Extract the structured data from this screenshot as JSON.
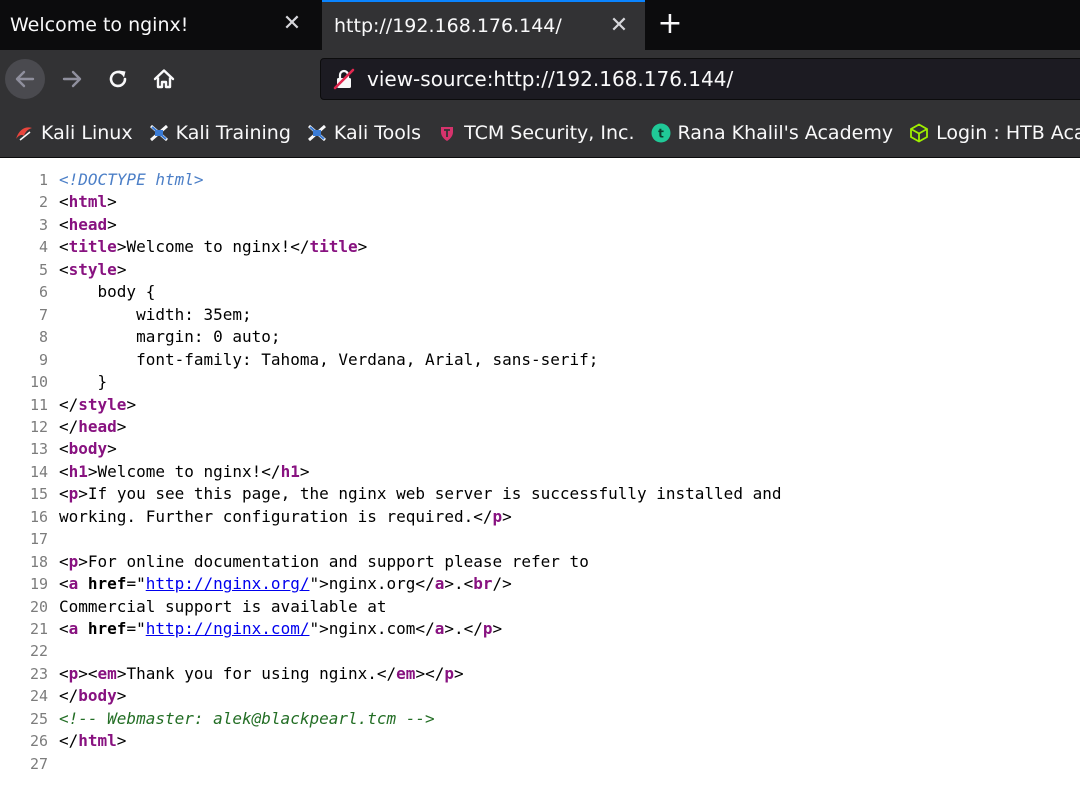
{
  "tabs": [
    {
      "title": "Welcome to nginx!",
      "active": false
    },
    {
      "title": "http://192.168.176.144/",
      "active": true
    }
  ],
  "icons": {
    "tab_close": "close-icon",
    "new_tab": "plus-icon",
    "back": "back-arrow-icon",
    "forward": "forward-arrow-icon",
    "reload": "reload-icon",
    "home": "home-icon",
    "insecure": "insecure-lock-icon"
  },
  "glyphs": {
    "close": "✕",
    "plus": "+"
  },
  "address_bar": {
    "url": "view-source:http://192.168.176.144/"
  },
  "bookmarks": [
    {
      "label": "Kali Linux",
      "icon": "kali-dragon-icon",
      "color": "#e8453c"
    },
    {
      "label": "Kali Training",
      "icon": "kali-training-icon",
      "color": "#3a7bd5"
    },
    {
      "label": "Kali Tools",
      "icon": "kali-tools-icon",
      "color": "#3a7bd5"
    },
    {
      "label": "TCM Security, Inc.",
      "icon": "tcm-icon",
      "color": "#d6336c"
    },
    {
      "label": "Rana Khalil's Academy",
      "icon": "rana-academy-icon",
      "color": "#20c997"
    },
    {
      "label": "Login : HTB Acad",
      "icon": "htb-cube-icon",
      "color": "#9fef00"
    }
  ],
  "colors": {
    "tag": "#881280",
    "doctype": "#4c7fc7",
    "comment": "#236e25",
    "link": "#0000ee",
    "line_number": "#7c7c7c",
    "active_tab_accent": "#0a84ff"
  },
  "source_lines": [
    [
      {
        "t": "doctype",
        "s": "<!DOCTYPE html>"
      }
    ],
    [
      {
        "t": "text",
        "s": "<"
      },
      {
        "t": "tag",
        "s": "html"
      },
      {
        "t": "text",
        "s": ">"
      }
    ],
    [
      {
        "t": "text",
        "s": "<"
      },
      {
        "t": "tag",
        "s": "head"
      },
      {
        "t": "text",
        "s": ">"
      }
    ],
    [
      {
        "t": "text",
        "s": "<"
      },
      {
        "t": "tag",
        "s": "title"
      },
      {
        "t": "text",
        "s": ">Welcome to nginx!</"
      },
      {
        "t": "tag",
        "s": "title"
      },
      {
        "t": "text",
        "s": ">"
      }
    ],
    [
      {
        "t": "text",
        "s": "<"
      },
      {
        "t": "tag",
        "s": "style"
      },
      {
        "t": "text",
        "s": ">"
      }
    ],
    [
      {
        "t": "text",
        "s": "    body {"
      }
    ],
    [
      {
        "t": "text",
        "s": "        width: 35em;"
      }
    ],
    [
      {
        "t": "text",
        "s": "        margin: 0 auto;"
      }
    ],
    [
      {
        "t": "text",
        "s": "        font-family: Tahoma, Verdana, Arial, sans-serif;"
      }
    ],
    [
      {
        "t": "text",
        "s": "    }"
      }
    ],
    [
      {
        "t": "text",
        "s": "</"
      },
      {
        "t": "tag",
        "s": "style"
      },
      {
        "t": "text",
        "s": ">"
      }
    ],
    [
      {
        "t": "text",
        "s": "</"
      },
      {
        "t": "tag",
        "s": "head"
      },
      {
        "t": "text",
        "s": ">"
      }
    ],
    [
      {
        "t": "text",
        "s": "<"
      },
      {
        "t": "tag",
        "s": "body"
      },
      {
        "t": "text",
        "s": ">"
      }
    ],
    [
      {
        "t": "text",
        "s": "<"
      },
      {
        "t": "tag",
        "s": "h1"
      },
      {
        "t": "text",
        "s": ">Welcome to nginx!</"
      },
      {
        "t": "tag",
        "s": "h1"
      },
      {
        "t": "text",
        "s": ">"
      }
    ],
    [
      {
        "t": "text",
        "s": "<"
      },
      {
        "t": "tag",
        "s": "p"
      },
      {
        "t": "text",
        "s": ">If you see this page, the nginx web server is successfully installed and"
      }
    ],
    [
      {
        "t": "text",
        "s": "working. Further configuration is required.</"
      },
      {
        "t": "tag",
        "s": "p"
      },
      {
        "t": "text",
        "s": ">"
      }
    ],
    [],
    [
      {
        "t": "text",
        "s": "<"
      },
      {
        "t": "tag",
        "s": "p"
      },
      {
        "t": "text",
        "s": ">For online documentation and support please refer to"
      }
    ],
    [
      {
        "t": "text",
        "s": "<"
      },
      {
        "t": "tag",
        "s": "a "
      },
      {
        "t": "attr",
        "s": "href"
      },
      {
        "t": "text",
        "s": "=\""
      },
      {
        "t": "link",
        "s": "http://nginx.org/"
      },
      {
        "t": "text",
        "s": "\">nginx.org</"
      },
      {
        "t": "tag",
        "s": "a"
      },
      {
        "t": "text",
        "s": ">.<"
      },
      {
        "t": "tag",
        "s": "br"
      },
      {
        "t": "text",
        "s": "/>"
      }
    ],
    [
      {
        "t": "text",
        "s": "Commercial support is available at"
      }
    ],
    [
      {
        "t": "text",
        "s": "<"
      },
      {
        "t": "tag",
        "s": "a "
      },
      {
        "t": "attr",
        "s": "href"
      },
      {
        "t": "text",
        "s": "=\""
      },
      {
        "t": "link",
        "s": "http://nginx.com/"
      },
      {
        "t": "text",
        "s": "\">nginx.com</"
      },
      {
        "t": "tag",
        "s": "a"
      },
      {
        "t": "text",
        "s": ">.</"
      },
      {
        "t": "tag",
        "s": "p"
      },
      {
        "t": "text",
        "s": ">"
      }
    ],
    [],
    [
      {
        "t": "text",
        "s": "<"
      },
      {
        "t": "tag",
        "s": "p"
      },
      {
        "t": "text",
        "s": "><"
      },
      {
        "t": "tag",
        "s": "em"
      },
      {
        "t": "text",
        "s": ">Thank you for using nginx.</"
      },
      {
        "t": "tag",
        "s": "em"
      },
      {
        "t": "text",
        "s": "></"
      },
      {
        "t": "tag",
        "s": "p"
      },
      {
        "t": "text",
        "s": ">"
      }
    ],
    [
      {
        "t": "text",
        "s": "</"
      },
      {
        "t": "tag",
        "s": "body"
      },
      {
        "t": "text",
        "s": ">"
      }
    ],
    [
      {
        "t": "comment",
        "s": "<!-- Webmaster: alek@blackpearl.tcm -->"
      }
    ],
    [
      {
        "t": "text",
        "s": "</"
      },
      {
        "t": "tag",
        "s": "html"
      },
      {
        "t": "text",
        "s": ">"
      }
    ],
    []
  ]
}
